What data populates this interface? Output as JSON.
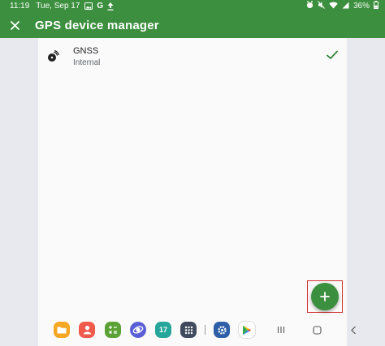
{
  "status_bar": {
    "time": "11:19",
    "date": "Tue, Sep 17",
    "battery": "36%",
    "left_icons": [
      "gallery-icon",
      "google-icon",
      "upload-icon"
    ],
    "right_icons": [
      "alarm-icon",
      "mute-icon",
      "wifi-icon",
      "signal-icon",
      "battery-icon"
    ]
  },
  "app_bar": {
    "title": "GPS device manager",
    "close_icon": "close-icon"
  },
  "devices": [
    {
      "name": "GNSS",
      "type": "Internal",
      "selected": true,
      "icon": "satellite-icon"
    }
  ],
  "fab": {
    "icon": "plus-icon"
  },
  "dock": {
    "apps": [
      "files-icon",
      "contacts-icon",
      "calculator-icon",
      "internet-icon",
      "calendar-icon",
      "app-drawer-icon",
      "settings-icon",
      "play-store-icon"
    ],
    "calendar_day": "17",
    "nav": [
      "recents-button",
      "home-button",
      "back-button"
    ]
  },
  "colors": {
    "primary": "#3c8f3e",
    "check": "#2e7d32",
    "highlight": "#d32f2f"
  }
}
